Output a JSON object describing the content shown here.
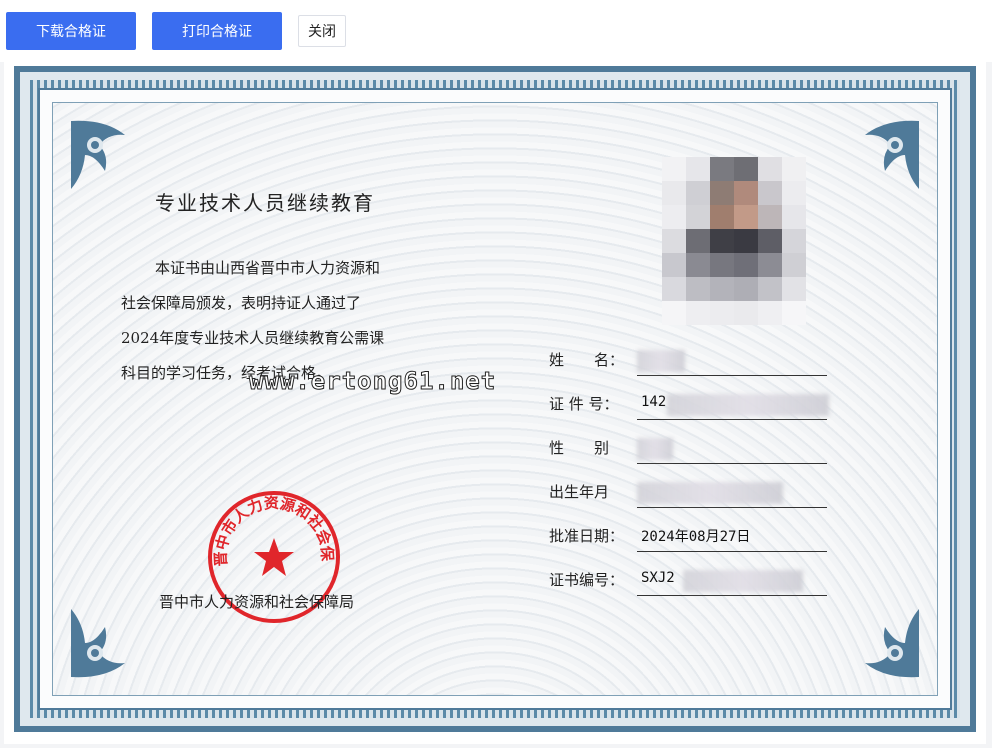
{
  "toolbar": {
    "download_label": "下载合格证",
    "print_label": "打印合格证",
    "close_label": "关闭"
  },
  "certificate": {
    "title": "专业技术人员继续教育",
    "body_lines": [
      "本证书由山西省晋中市人力资源和",
      "社会保障局颁发，表明持证人通过了",
      "2024年度专业技术人员继续教育公需课",
      "科目的学习任务，经考试合格。"
    ],
    "watermark": "www.ertong61.net",
    "issuer": "晋中市人力资源和社会保障局",
    "seal_text": "晋中市人力资源和社会保障局",
    "fields": [
      {
        "label": "姓　　名：",
        "value": ""
      },
      {
        "label": "证 件 号：",
        "value": "142"
      },
      {
        "label": "性　　别",
        "value": ""
      },
      {
        "label": "出生年月",
        "value": ""
      },
      {
        "label": "批准日期：",
        "value": "2024年08月27日"
      },
      {
        "label": "证书编号：",
        "value": "SXJ2"
      }
    ]
  },
  "colors": {
    "primary_button": "#3a6df0",
    "border_blue": "#4f7a99",
    "seal_red": "#e0262b"
  }
}
